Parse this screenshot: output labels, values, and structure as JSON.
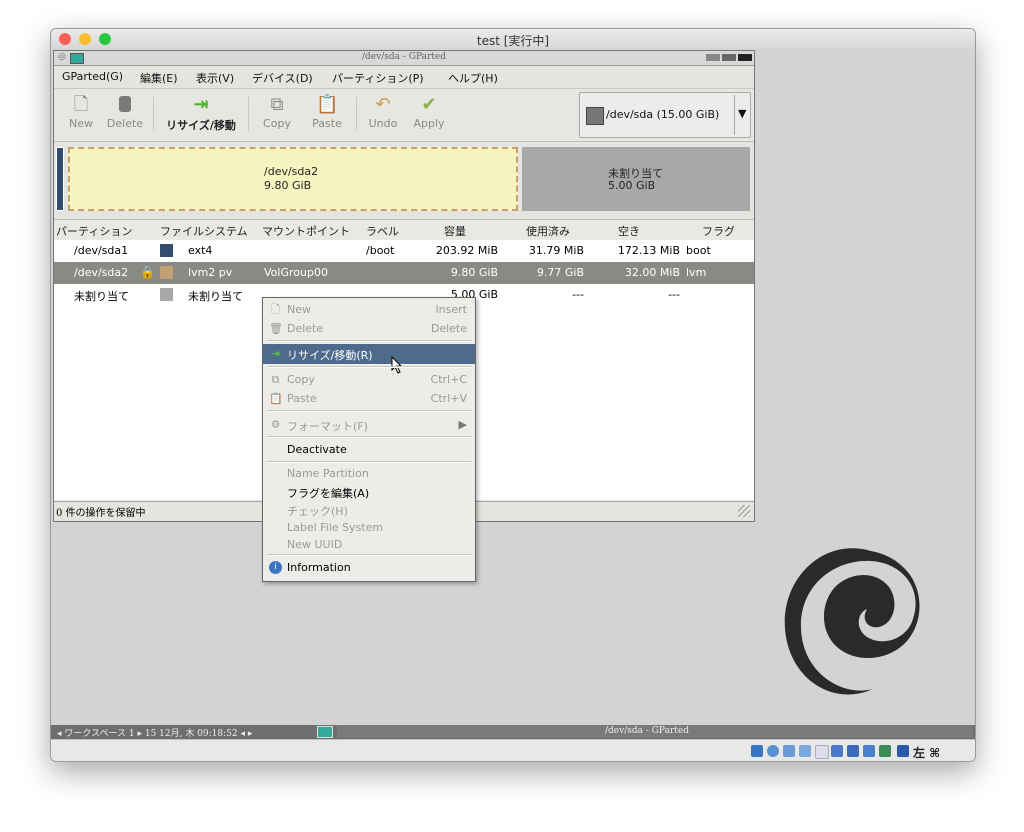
{
  "mac_window": {
    "title": "test [実行中]"
  },
  "gparted": {
    "title": "/dev/sda - GParted",
    "menu": [
      "GParted(G)",
      "編集(E)",
      "表示(V)",
      "デバイス(D)",
      "パーティション(P)",
      "ヘルプ(H)"
    ],
    "toolbar": {
      "new": "New",
      "delete": "Delete",
      "resize": "リサイズ/移動",
      "copy": "Copy",
      "paste": "Paste",
      "undo": "Undo",
      "apply": "Apply"
    },
    "device_selector": "/dev/sda  (15.00 GiB)",
    "graph": {
      "p1_name": "/dev/sda2",
      "p1_size": "9.80 GiB",
      "p2_name": "未割り当て",
      "p2_size": "5.00 GiB"
    },
    "columns": [
      "パーティション",
      "ファイルシステム",
      "マウントポイント",
      "ラベル",
      "容量",
      "使用済み",
      "空き",
      "フラグ"
    ],
    "rows": [
      {
        "partition": "/dev/sda1",
        "fs": "ext4",
        "mount": "",
        "label": "/boot",
        "size": "203.92 MiB",
        "used": "31.79 MiB",
        "free": "172.13 MiB",
        "flags": "boot",
        "color": "#314e6c"
      },
      {
        "partition": "/dev/sda2",
        "fs": "lvm2 pv",
        "mount": "VolGroup00",
        "label": "",
        "size": "9.80 GiB",
        "used": "9.77 GiB",
        "free": "32.00 MiB",
        "flags": "lvm",
        "color": "#c1a073"
      },
      {
        "partition": "未割り当て",
        "fs": "未割り当て",
        "mount": "",
        "label": "",
        "size": "5.00 GiB",
        "used": "---",
        "free": "---",
        "flags": "",
        "color": "#a8a8a8"
      }
    ],
    "status": "0 件の操作を保留中"
  },
  "context_menu": {
    "new": "New",
    "new_acc": "Insert",
    "delete": "Delete",
    "delete_acc": "Delete",
    "resize": "リサイズ/移動(R)",
    "copy": "Copy",
    "copy_acc": "Ctrl+C",
    "paste": "Paste",
    "paste_acc": "Ctrl+V",
    "format": "フォーマット(F)",
    "deactivate": "Deactivate",
    "name_partition": "Name Partition",
    "edit_flags": "フラグを編集(A)",
    "check": "チェック(H)",
    "label_fs": "Label File System",
    "new_uuid": "New UUID",
    "information": "Information"
  },
  "panel": {
    "workspace": "◂ ワークスペース 1 ▸  15 12月, 木 09:18:52  ◂ ▸",
    "task": "/dev/sda - GParted"
  },
  "vbox_status": {
    "host_key": "左 ⌘"
  }
}
